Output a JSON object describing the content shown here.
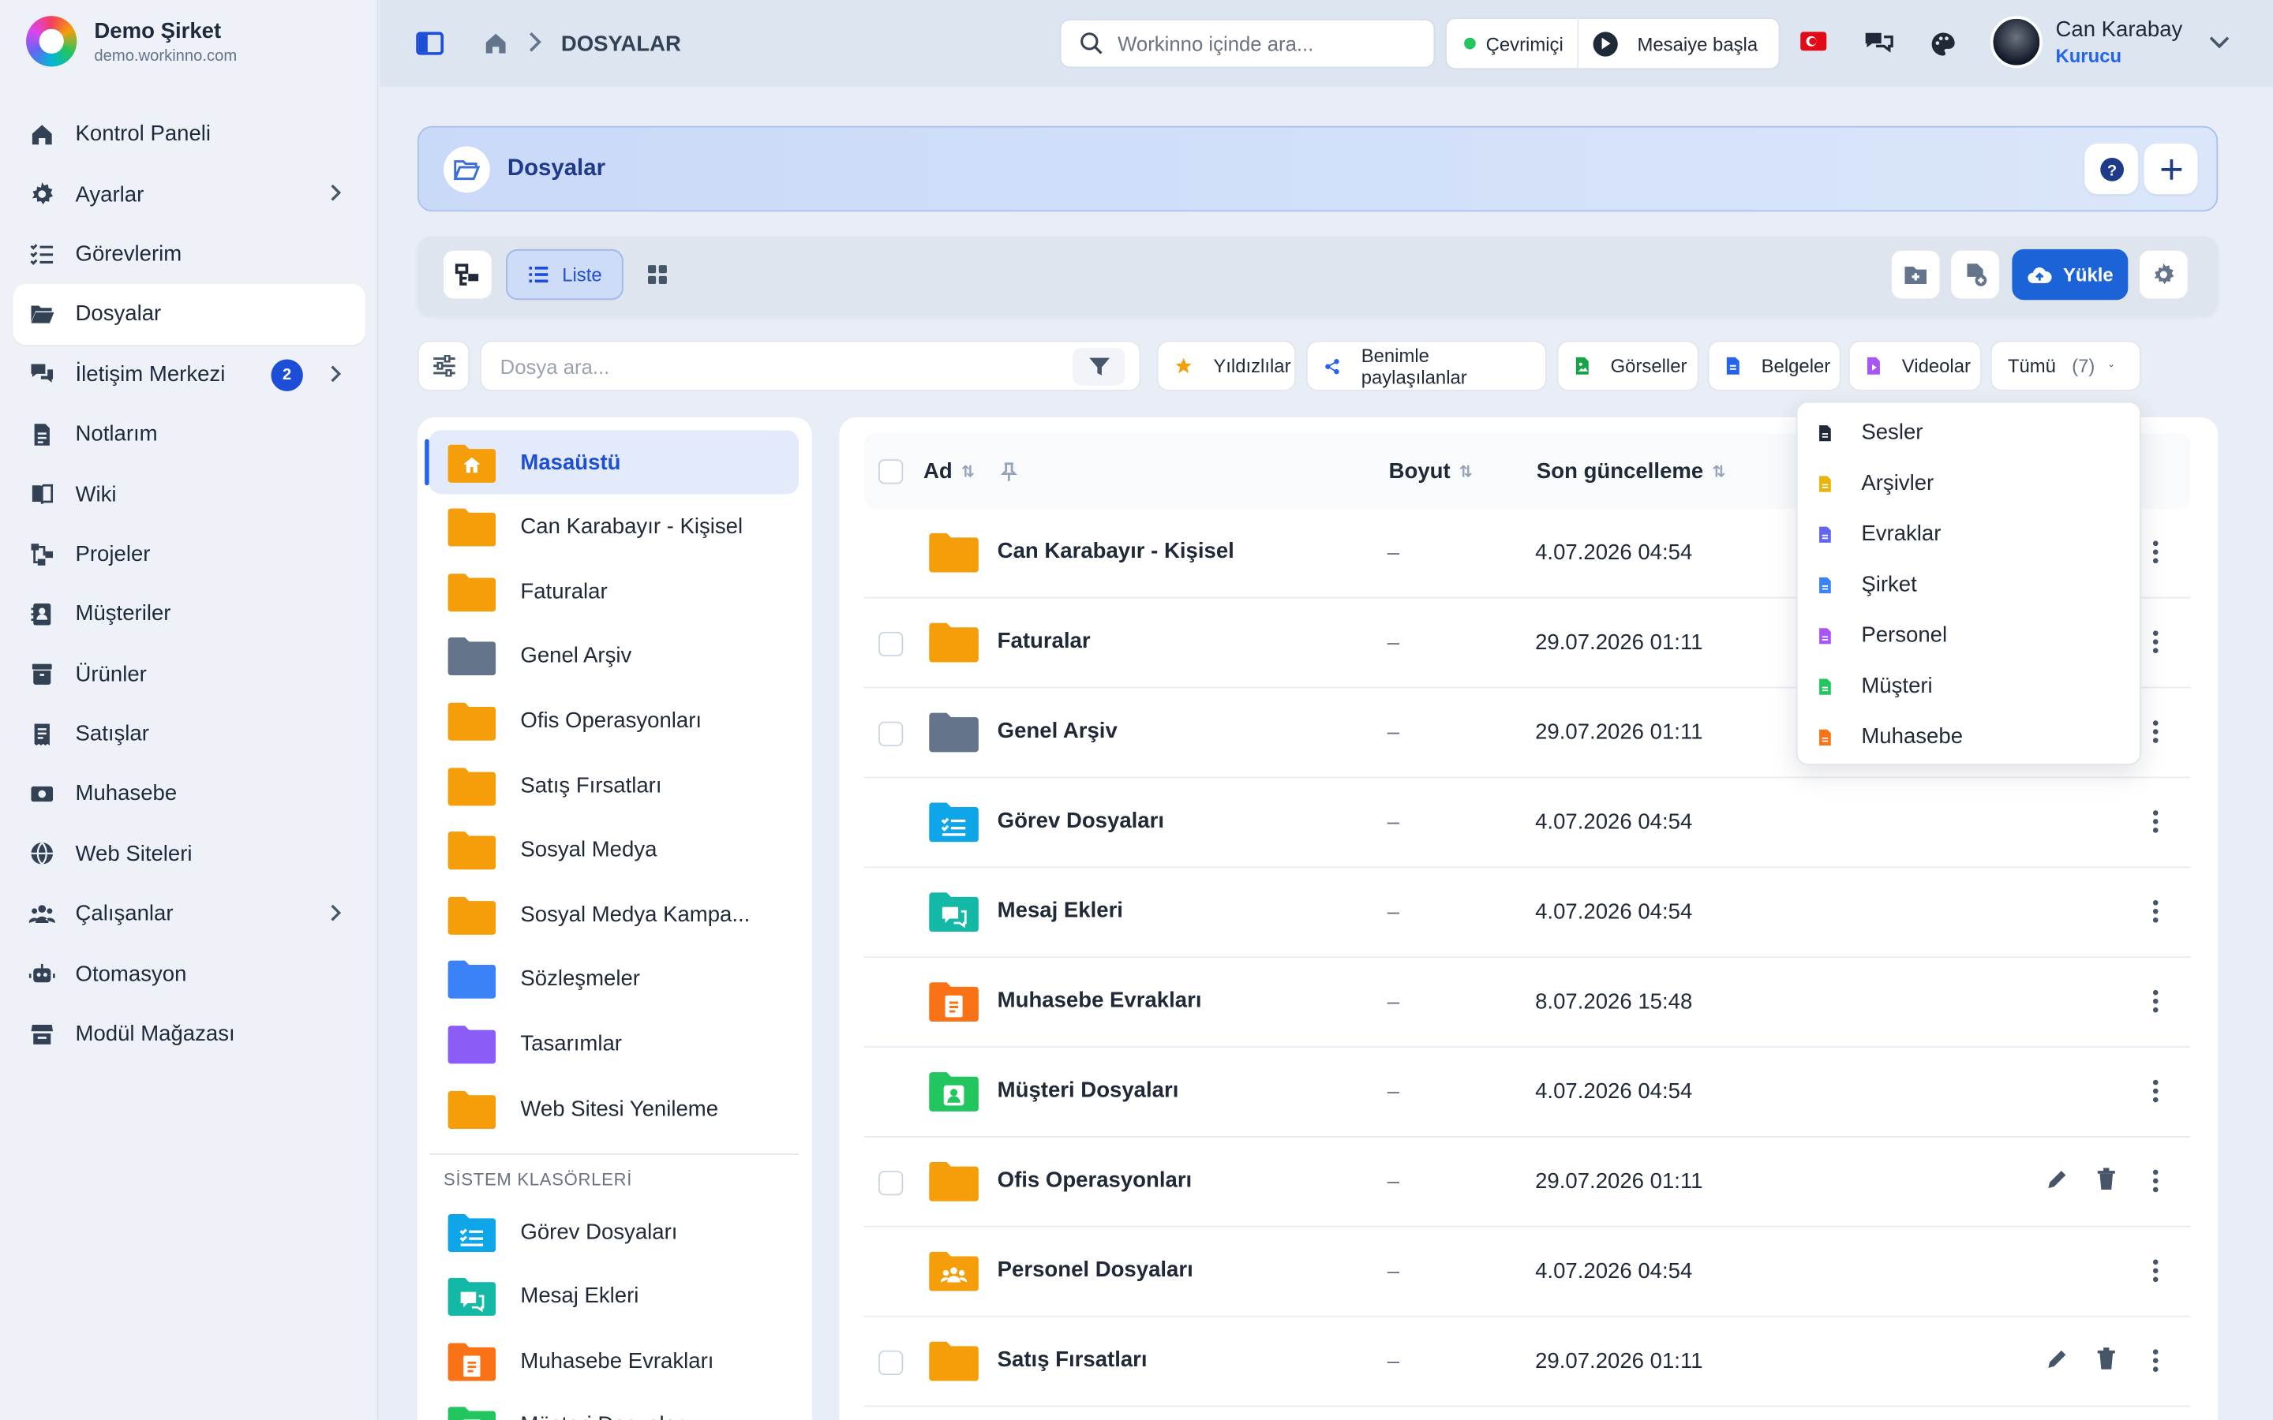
{
  "brand": {
    "name": "Demo Şirket",
    "url": "demo.workinno.com"
  },
  "sidebar": {
    "items": [
      {
        "label": "Kontrol Paneli",
        "icon": "home-icon"
      },
      {
        "label": "Ayarlar",
        "icon": "gear-icon",
        "chevron": true
      },
      {
        "label": "Görevlerim",
        "icon": "task-list-icon"
      },
      {
        "label": "Dosyalar",
        "icon": "folder-open-icon",
        "active": true
      },
      {
        "label": "İletişim Merkezi",
        "icon": "chat-icon",
        "badge": "2",
        "chevron": true
      },
      {
        "label": "Notlarım",
        "icon": "note-icon"
      },
      {
        "label": "Wiki",
        "icon": "book-icon"
      },
      {
        "label": "Projeler",
        "icon": "project-icon"
      },
      {
        "label": "Müşteriler",
        "icon": "contact-icon"
      },
      {
        "label": "Ürünler",
        "icon": "box-icon"
      },
      {
        "label": "Satışlar",
        "icon": "receipt-icon"
      },
      {
        "label": "Muhasebe",
        "icon": "money-icon"
      },
      {
        "label": "Web Siteleri",
        "icon": "globe-icon"
      },
      {
        "label": "Çalışanlar",
        "icon": "users-icon",
        "chevron": true
      },
      {
        "label": "Otomasyon",
        "icon": "robot-icon"
      },
      {
        "label": "Modül Mağazası",
        "icon": "store-icon"
      }
    ]
  },
  "header": {
    "breadcrumb": "DOSYALAR",
    "search_placeholder": "Workinno içinde ara...",
    "status": "Çevrimiçi",
    "start_shift": "Mesaiye başla",
    "user_name": "Can Karabay",
    "user_role": "Kurucu"
  },
  "page": {
    "title": "Dosyalar"
  },
  "toolbar": {
    "list_label": "Liste",
    "upload_label": "Yükle"
  },
  "filters": {
    "search_placeholder": "Dosya ara...",
    "chips": [
      {
        "label": "Yıldızlılar",
        "color": "#f59e0b"
      },
      {
        "label": "Benimle paylaşılanlar",
        "color": "#2563eb"
      },
      {
        "label": "Görseller",
        "color": "#16a34a"
      },
      {
        "label": "Belgeler",
        "color": "#2563eb"
      },
      {
        "label": "Videolar",
        "color": "#a855f7"
      }
    ],
    "all_label": "Tümü",
    "all_count": "(7)"
  },
  "tree": {
    "folders": [
      {
        "label": "Masaüstü",
        "color": "#f59e0b",
        "active": true,
        "kind": "home"
      },
      {
        "label": "Can Karabayır - Kişisel",
        "color": "#f59e0b"
      },
      {
        "label": "Faturalar",
        "color": "#f59e0b"
      },
      {
        "label": "Genel Arşiv",
        "color": "#64748b"
      },
      {
        "label": "Ofis Operasyonları",
        "color": "#f59e0b"
      },
      {
        "label": "Satış Fırsatları",
        "color": "#f59e0b"
      },
      {
        "label": "Sosyal Medya",
        "color": "#f59e0b"
      },
      {
        "label": "Sosyal Medya Kampa...",
        "color": "#f59e0b"
      },
      {
        "label": "Sözleşmeler",
        "color": "#3b82f6"
      },
      {
        "label": "Tasarımlar",
        "color": "#8b5cf6"
      },
      {
        "label": "Web Sitesi Yenileme",
        "color": "#f59e0b"
      }
    ],
    "system_heading": "SİSTEM KLASÖRLERİ",
    "system": [
      {
        "label": "Görev Dosyaları",
        "color": "#0ea5e9",
        "kind": "task"
      },
      {
        "label": "Mesaj Ekleri",
        "color": "#14b8a6",
        "kind": "chat"
      },
      {
        "label": "Muhasebe Evrakları",
        "color": "#f97316",
        "kind": "doc"
      },
      {
        "label": "Müşteri Dosyaları",
        "color": "#22c55e",
        "kind": "user"
      }
    ]
  },
  "table": {
    "headers": {
      "name": "Ad",
      "size": "Boyut",
      "updated": "Son güncelleme"
    },
    "rows": [
      {
        "name": "Can Karabayır - Kişisel",
        "size": "–",
        "date": "4.07.2026 04:54",
        "color": "#f59e0b",
        "checkbox": false,
        "kind": "plain"
      },
      {
        "name": "Faturalar",
        "size": "–",
        "date": "29.07.2026 01:11",
        "color": "#f59e0b",
        "checkbox": true,
        "kind": "plain"
      },
      {
        "name": "Genel Arşiv",
        "size": "–",
        "date": "29.07.2026 01:11",
        "color": "#64748b",
        "checkbox": true,
        "kind": "plain"
      },
      {
        "name": "Görev Dosyaları",
        "size": "–",
        "date": "4.07.2026 04:54",
        "color": "#0ea5e9",
        "checkbox": false,
        "kind": "task"
      },
      {
        "name": "Mesaj Ekleri",
        "size": "–",
        "date": "4.07.2026 04:54",
        "color": "#14b8a6",
        "checkbox": false,
        "kind": "chat"
      },
      {
        "name": "Muhasebe Evrakları",
        "size": "–",
        "date": "8.07.2026 15:48",
        "color": "#f97316",
        "checkbox": false,
        "kind": "doc"
      },
      {
        "name": "Müşteri Dosyaları",
        "size": "–",
        "date": "4.07.2026 04:54",
        "color": "#22c55e",
        "checkbox": false,
        "kind": "user"
      },
      {
        "name": "Ofis Operasyonları",
        "size": "–",
        "date": "29.07.2026 01:11",
        "color": "#f59e0b",
        "checkbox": true,
        "kind": "plain",
        "actions": true
      },
      {
        "name": "Personel Dosyaları",
        "size": "–",
        "date": "4.07.2026 04:54",
        "color": "#f59e0b",
        "checkbox": false,
        "kind": "users"
      },
      {
        "name": "Satış Fırsatları",
        "size": "–",
        "date": "29.07.2026 01:11",
        "color": "#f59e0b",
        "checkbox": true,
        "kind": "plain",
        "actions": true
      }
    ]
  },
  "dropdown": {
    "items": [
      {
        "label": "Sesler",
        "color": "#1f2937"
      },
      {
        "label": "Arşivler",
        "color": "#eab308"
      },
      {
        "label": "Evraklar",
        "color": "#6366f1"
      },
      {
        "label": "Şirket",
        "color": "#3b82f6"
      },
      {
        "label": "Personel",
        "color": "#a855f7"
      },
      {
        "label": "Müşteri",
        "color": "#22c55e"
      },
      {
        "label": "Muhasebe",
        "color": "#f97316"
      }
    ]
  }
}
